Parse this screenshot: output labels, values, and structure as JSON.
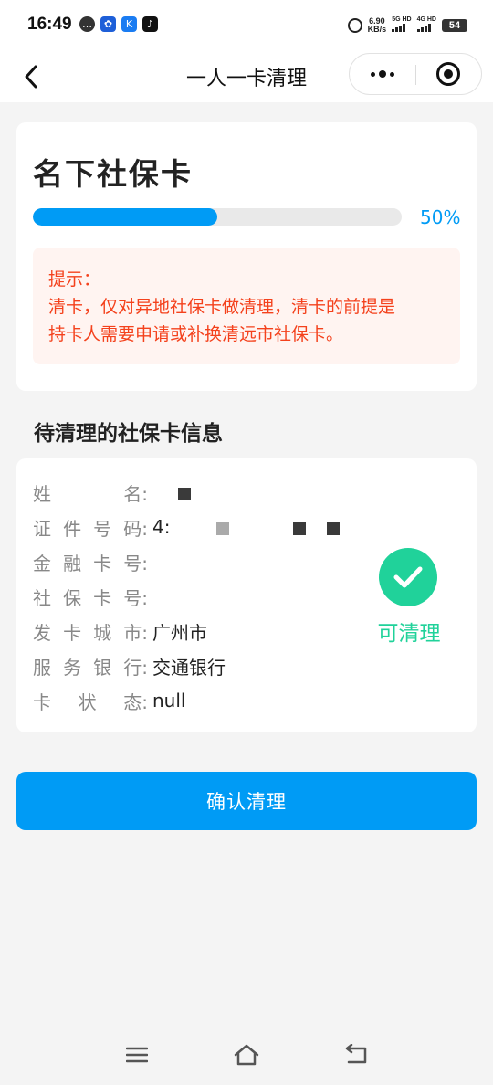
{
  "status_bar": {
    "time": "16:49",
    "net_speed_value": "6.90",
    "net_speed_unit": "KB/s",
    "sim1_label": "5G HD",
    "sim2_label": "4G HD",
    "battery": "54",
    "app_icons": [
      "message-icon",
      "baidu-paw-icon",
      "kuake-k-icon",
      "tiktok-icon"
    ]
  },
  "nav": {
    "title": "一人一卡清理"
  },
  "card": {
    "title": "名下社保卡",
    "progress_percent": 50,
    "progress_label": "50%",
    "notice_title": "提示：",
    "notice_line1": "清卡，仅对异地社保卡做清理，清卡的前提是",
    "notice_line2": "持卡人需要申请或补换清远市社保卡。"
  },
  "section": {
    "title": "待清理的社保卡信息"
  },
  "info": {
    "rows": [
      {
        "label_chars": [
          "姓",
          "名:"
        ],
        "value": ""
      },
      {
        "label_chars": [
          "证",
          "件",
          "号",
          "码:"
        ],
        "value": "4:"
      },
      {
        "label_chars": [
          "金",
          "融",
          "卡",
          "号:"
        ],
        "value": ""
      },
      {
        "label_chars": [
          "社",
          "保",
          "卡",
          "号:"
        ],
        "value": ""
      },
      {
        "label_chars": [
          "发",
          "卡",
          "城",
          "市:"
        ],
        "value": "广州市"
      },
      {
        "label_chars": [
          "服",
          "务",
          "银",
          "行:"
        ],
        "value": "交通银行"
      },
      {
        "label_chars": [
          "卡",
          "状",
          "态:"
        ],
        "value": "null"
      }
    ],
    "status_text": "可清理",
    "status_color": "#20d29a"
  },
  "actions": {
    "confirm_label": "确认清理",
    "accent_color": "#009bf5"
  }
}
